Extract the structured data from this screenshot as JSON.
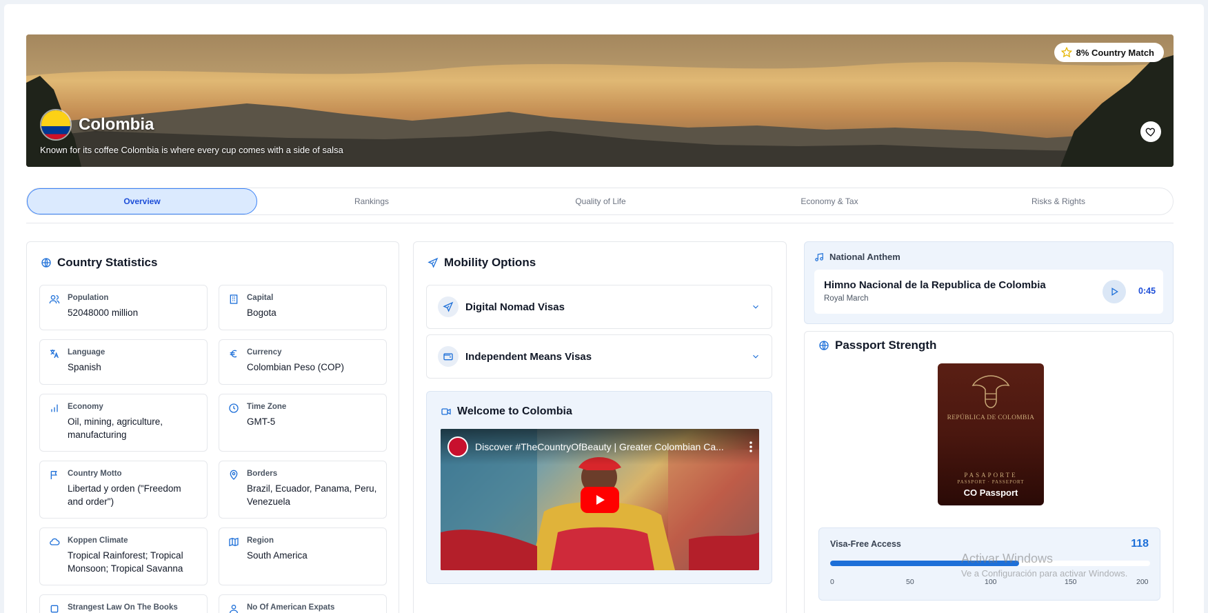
{
  "hero": {
    "country": "Colombia",
    "tagline": "Known for its coffee Colombia is where every cup comes with a side of salsa",
    "match_label": "8% Country Match"
  },
  "tabs": [
    {
      "label": "Overview",
      "active": true
    },
    {
      "label": "Rankings",
      "active": false
    },
    {
      "label": "Quality of Life",
      "active": false
    },
    {
      "label": "Economy & Tax",
      "active": false
    },
    {
      "label": "Risks & Rights",
      "active": false
    }
  ],
  "stats": {
    "title": "Country Statistics",
    "items": [
      {
        "label": "Population",
        "value": "52048000 million",
        "icon": "users-icon"
      },
      {
        "label": "Capital",
        "value": "Bogota",
        "icon": "building-icon"
      },
      {
        "label": "Language",
        "value": "Spanish",
        "icon": "translate-icon"
      },
      {
        "label": "Currency",
        "value": "Colombian Peso (COP)",
        "icon": "euro-icon"
      },
      {
        "label": "Economy",
        "value": "Oil, mining, agriculture, manufacturing",
        "icon": "bar-chart-icon"
      },
      {
        "label": "Time Zone",
        "value": "GMT-5",
        "icon": "clock-icon"
      },
      {
        "label": "Country Motto",
        "value": "Libertad y orden (\"Freedom and order\")",
        "icon": "flag-icon"
      },
      {
        "label": "Borders",
        "value": "Brazil, Ecuador, Panama, Peru, Venezuela",
        "icon": "map-pin-icon"
      },
      {
        "label": "Koppen Climate",
        "value": "Tropical Rainforest; Tropical Monsoon; Tropical Savanna",
        "icon": "cloud-icon"
      },
      {
        "label": "Region",
        "value": "South America",
        "icon": "map-icon"
      },
      {
        "label": "Strangest Law On The Books",
        "value": "",
        "icon": "square-icon"
      },
      {
        "label": "No Of American Expats",
        "value": "",
        "icon": "user-icon"
      }
    ]
  },
  "mobility": {
    "title": "Mobility Options",
    "visas": [
      {
        "label": "Digital Nomad Visas",
        "icon": "plane-icon"
      },
      {
        "label": "Independent Means Visas",
        "icon": "wallet-icon"
      }
    ],
    "welcome_title": "Welcome to Colombia",
    "video_title": "Discover #TheCountryOfBeauty | Greater Colombian Ca..."
  },
  "anthem": {
    "header": "National Anthem",
    "song": "Himno Nacional de la Republica de Colombia",
    "subtitle": "Royal March",
    "duration": "0:45"
  },
  "passport": {
    "title": "Passport Strength",
    "republic": "REPÚBLICA DE COLOMBIA",
    "pasaporte": "PASAPORTE",
    "pasaporte_sub": "PASSPORT · PASSEPORT",
    "name": "CO Passport",
    "visa_free_label": "Visa-Free Access",
    "visa_free_count": "118",
    "visa_free_value": 118,
    "visa_free_max": 200,
    "ticks": [
      "0",
      "50",
      "100",
      "150",
      "200"
    ]
  },
  "watermark": {
    "line1": "Activar Windows",
    "line2": "Ve a Configuración para activar Windows."
  },
  "colors": {
    "accent": "#1d6fd8",
    "tab_active_bg": "#dbeafe",
    "youtube_red": "#ff0000"
  }
}
